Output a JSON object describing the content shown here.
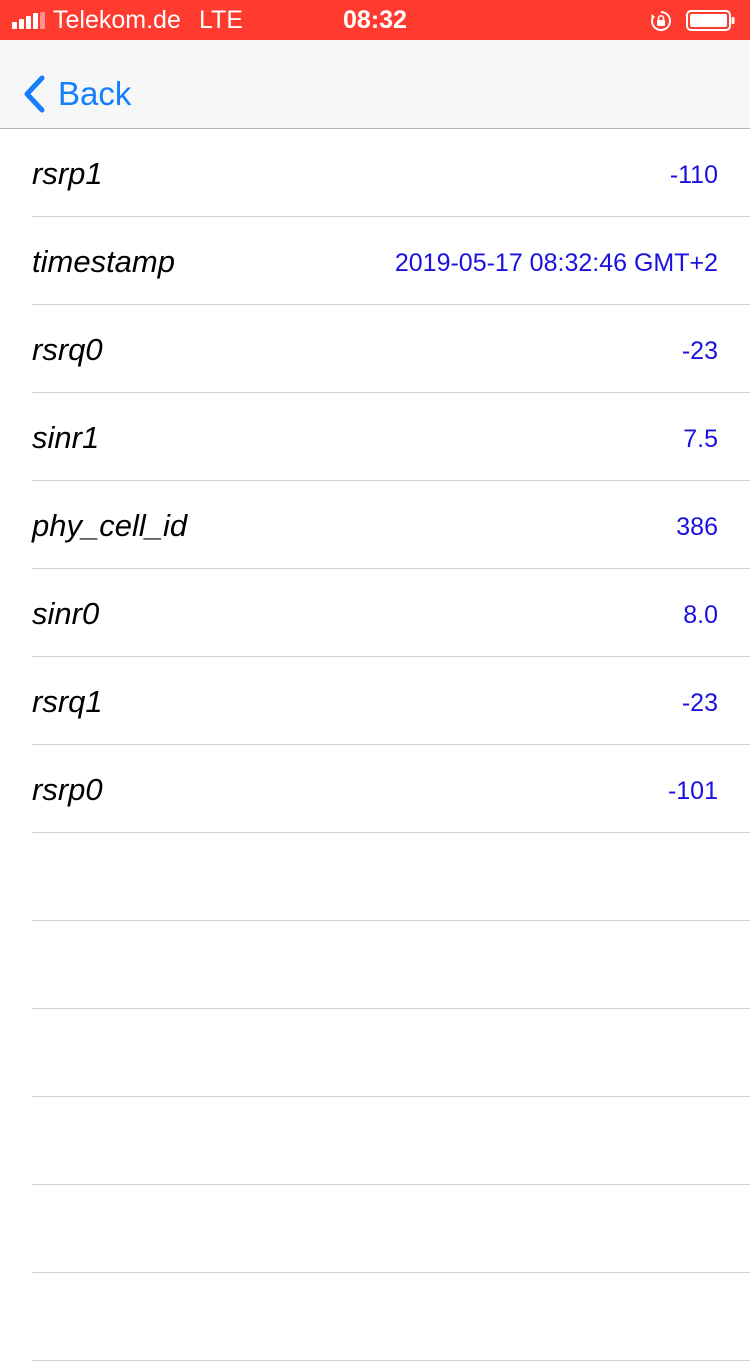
{
  "status_bar": {
    "carrier": "Telekom.de",
    "network": "LTE",
    "time": "08:32",
    "signal_bars_filled": 4,
    "signal_bars_total": 5,
    "battery_level": 1.0,
    "icons": [
      "signal-icon",
      "orientation-lock-icon",
      "battery-icon"
    ],
    "color": "#ff3b30"
  },
  "nav": {
    "back_label": "Back",
    "back_icon": "chevron-left-icon",
    "accent": "#147efb"
  },
  "rows": [
    {
      "key": "rsrp1",
      "value": "-110"
    },
    {
      "key": "timestamp",
      "value": "2019-05-17 08:32:46 GMT+2"
    },
    {
      "key": "rsrq0",
      "value": "-23"
    },
    {
      "key": "sinr1",
      "value": "7.5"
    },
    {
      "key": "phy_cell_id",
      "value": "386"
    },
    {
      "key": "sinr0",
      "value": "8.0"
    },
    {
      "key": "rsrq1",
      "value": "-23"
    },
    {
      "key": "rsrp0",
      "value": "-101"
    },
    {
      "key": "",
      "value": ""
    },
    {
      "key": "",
      "value": ""
    },
    {
      "key": "",
      "value": ""
    },
    {
      "key": "",
      "value": ""
    },
    {
      "key": "",
      "value": ""
    },
    {
      "key": "",
      "value": ""
    }
  ],
  "colors": {
    "value_text": "#1a10e0",
    "key_text": "#000000"
  }
}
